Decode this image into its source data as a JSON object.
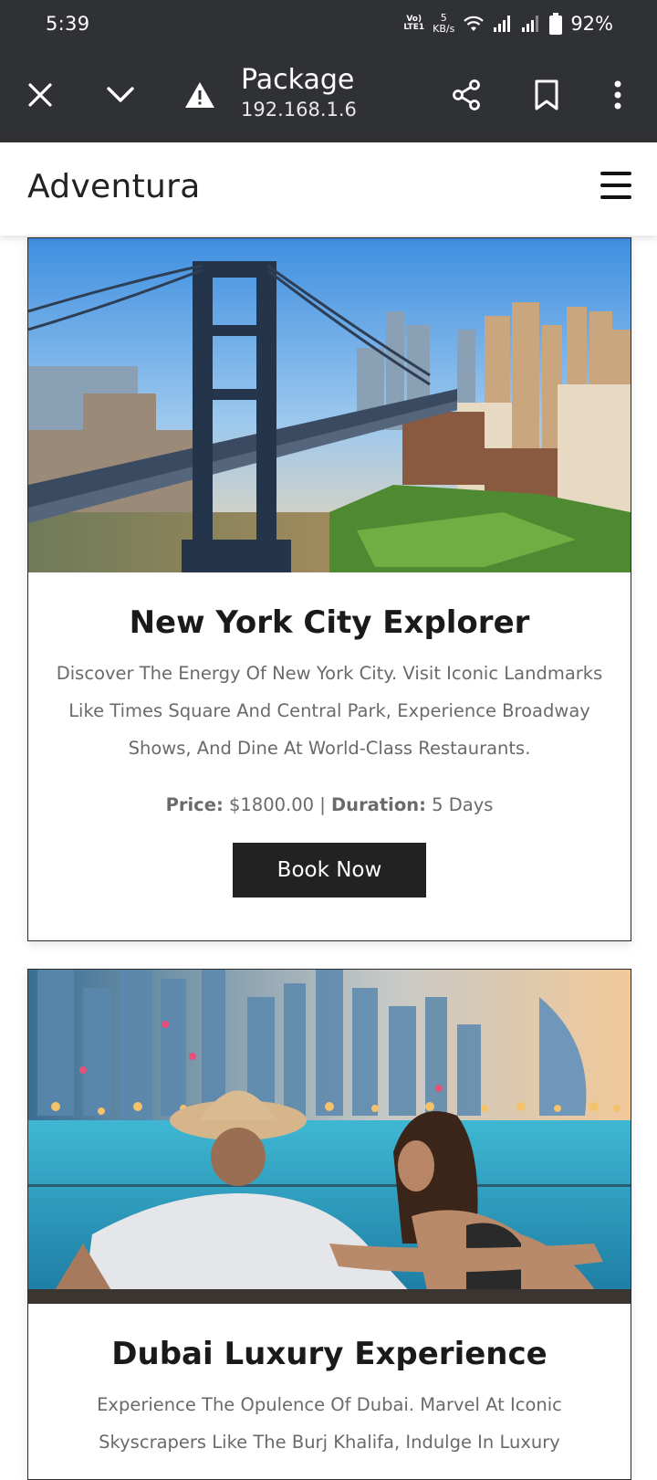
{
  "status_bar": {
    "time": "5:39",
    "volte_top": "Vo)",
    "volte_bottom": "LTE1",
    "net_speed_value": "5",
    "net_speed_unit": "KB/s",
    "battery": "92%"
  },
  "browser": {
    "title": "Package",
    "url": "192.168.1.6",
    "icons": [
      "close-icon",
      "chevron-down-icon",
      "warning-icon",
      "share-icon",
      "bookmark-icon",
      "more-vertical-icon"
    ]
  },
  "site": {
    "brand": "Adventura"
  },
  "packages": [
    {
      "title": "New York City Explorer",
      "description": "Discover The Energy Of New York City. Visit Iconic Landmarks Like Times Square And Central Park, Experience Broadway Shows, And Dine At World-Class Restaurants.",
      "price_label": "Price:",
      "price": "$1800.00",
      "separator": "|",
      "duration_label": "Duration:",
      "duration": "5 Days",
      "button": "Book Now"
    },
    {
      "title": "Dubai Luxury Experience",
      "description": "Experience The Opulence Of Dubai. Marvel At Iconic Skyscrapers Like The Burj Khalifa, Indulge In Luxury"
    }
  ],
  "colors": {
    "chrome": "#303134",
    "button": "#222222",
    "text_muted": "#6a6a6a"
  }
}
